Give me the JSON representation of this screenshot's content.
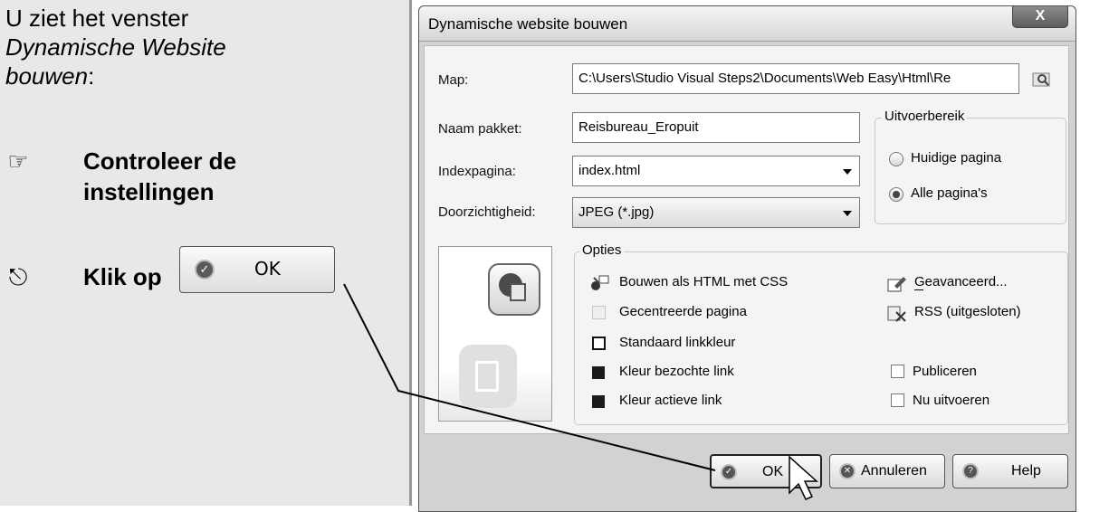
{
  "instructions": {
    "intro_line1": "U ziet het venster",
    "intro_line2": "Dynamische Website",
    "intro_line3": "bouwen",
    "intro_suffix": ":",
    "step1_line1": "Controleer de",
    "step1_line2": "instellingen",
    "step2_text": "Klik op",
    "step2_button": "OK"
  },
  "dialog": {
    "title": "Dynamische website bouwen",
    "close_label": "X",
    "map_label": "Map:",
    "map_value": "C:\\Users\\Studio Visual Steps2\\Documents\\Web Easy\\Html\\Re",
    "package_label": "Naam pakket:",
    "package_value": "Reisbureau_Eropuit",
    "index_label": "Indexpagina:",
    "index_value": "index.html",
    "transparency_label": "Doorzichtigheid:",
    "transparency_value": "JPEG (*.jpg)",
    "scope": {
      "title": "Uitvoerbereik",
      "option_current": "Huidige pagina",
      "option_all": "Alle pagina's",
      "selected": "Alle pagina's"
    },
    "options": {
      "title": "Opties",
      "build_html_css": "Bouwen als HTML met CSS",
      "centered_page": "Gecentreerde pagina",
      "default_link_color": "Standaard linkkleur",
      "visited_link_color": "Kleur bezochte link",
      "active_link_color": "Kleur actieve link",
      "advanced": "Geavanceerd...",
      "rss": "RSS (uitgesloten)",
      "publish": "Publiceren",
      "run_now": "Nu uitvoeren"
    },
    "buttons": {
      "ok": "OK",
      "cancel": "Annuleren",
      "help": "Help"
    }
  }
}
